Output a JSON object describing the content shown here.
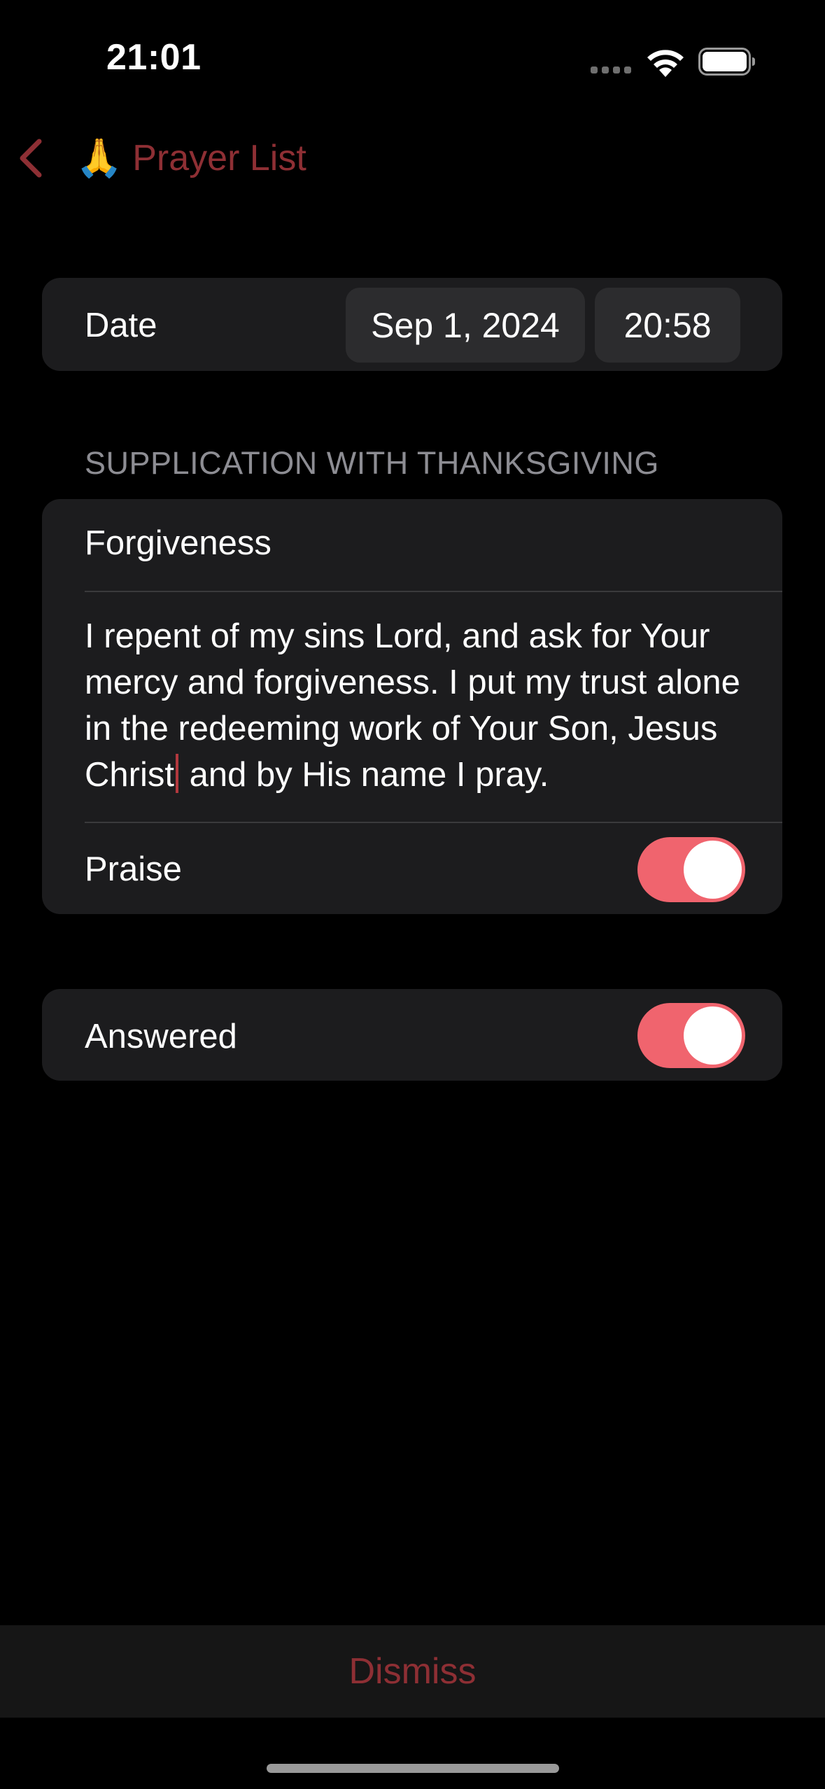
{
  "status_bar": {
    "time": "21:01",
    "icons": [
      "cellular-signal-icon",
      "wifi-icon",
      "battery-icon"
    ]
  },
  "nav": {
    "back_emoji": "🙏",
    "back_label": "Prayer List",
    "accent_color": "#8e2f34"
  },
  "date_row": {
    "label": "Date",
    "date": "Sep 1, 2024",
    "time": "20:58"
  },
  "section": {
    "header": "SUPPLICATION WITH THANKSGIVING",
    "title": "Forgiveness",
    "body_before_cursor": "I repent of my sins Lord, and ask for Your mercy and forgiveness. I put my trust alone in the redeeming work of Your Son, Jesus Christ",
    "body_after_cursor": " and by His name I pray.",
    "praise_label": "Praise",
    "praise_on": true
  },
  "answered": {
    "label": "Answered",
    "on": true
  },
  "toggle_color": "#f0646e",
  "footer": {
    "dismiss_label": "Dismiss"
  }
}
